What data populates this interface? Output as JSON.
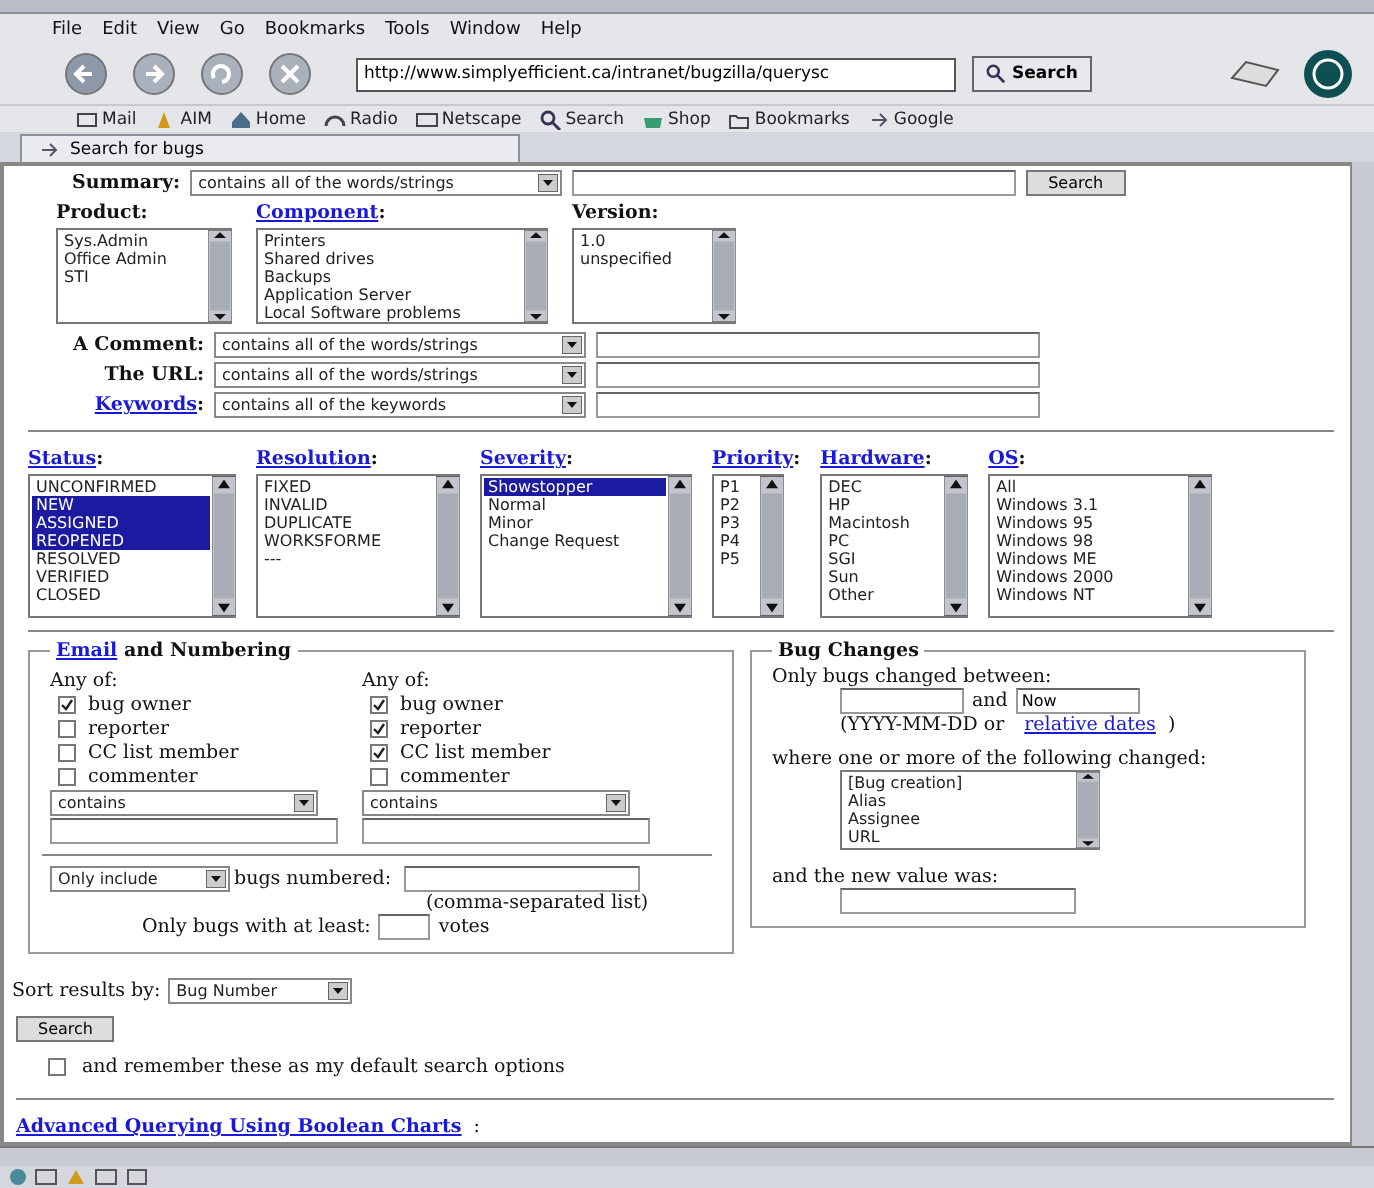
{
  "menu": [
    "File",
    "Edit",
    "View",
    "Go",
    "Bookmarks",
    "Tools",
    "Window",
    "Help"
  ],
  "navigation": {
    "url": "http://www.simplyefficient.ca/intranet/bugzilla/querysc",
    "search_button": "Search"
  },
  "personal_bar": [
    {
      "kind": "mail",
      "label": "Mail"
    },
    {
      "kind": "aim",
      "label": "AIM"
    },
    {
      "kind": "home",
      "label": "Home"
    },
    {
      "kind": "radio",
      "label": "Radio"
    },
    {
      "kind": "netscape",
      "label": "Netscape"
    },
    {
      "kind": "search",
      "label": "Search"
    },
    {
      "kind": "shop",
      "label": "Shop"
    },
    {
      "kind": "folder",
      "label": "Bookmarks"
    },
    {
      "kind": "link",
      "label": "Google"
    }
  ],
  "tab": {
    "label": "Search for bugs",
    "selected": true
  },
  "summary": {
    "label": "Summary:",
    "operator": "contains all of the words/strings",
    "button": "Search"
  },
  "pickers": [
    {
      "label": "Product",
      "link": false,
      "colon": ":",
      "options": [
        {
          "text": "Sys.Admin",
          "selected": false
        },
        {
          "text": "Office Admin",
          "selected": false
        },
        {
          "text": "STI",
          "selected": false
        }
      ]
    },
    {
      "label": "Component",
      "link": true,
      "colon": ":",
      "options": [
        {
          "text": "Printers",
          "selected": false
        },
        {
          "text": "Shared drives",
          "selected": false
        },
        {
          "text": "Backups",
          "selected": false
        },
        {
          "text": "Application Server",
          "selected": false
        },
        {
          "text": "Local Software problems",
          "selected": false
        }
      ]
    },
    {
      "label": "Version",
      "link": false,
      "colon": ":",
      "options": [
        {
          "text": "1.0",
          "selected": false
        },
        {
          "text": "unspecified",
          "selected": false
        }
      ]
    }
  ],
  "text_rows": [
    {
      "label": "A Comment",
      "link": false,
      "colon": ":",
      "operator": "contains all of the words/strings"
    },
    {
      "label": "The URL",
      "link": false,
      "colon": ":",
      "operator": "contains all of the words/strings"
    },
    {
      "label": "Keywords",
      "link": true,
      "colon": ":",
      "operator": "contains all of the keywords"
    }
  ],
  "filters": [
    {
      "label": "Status",
      "colon": ":",
      "options": [
        {
          "text": "UNCONFIRMED",
          "selected": false
        },
        {
          "text": "NEW",
          "selected": true
        },
        {
          "text": "ASSIGNED",
          "selected": true
        },
        {
          "text": "REOPENED",
          "selected": true
        },
        {
          "text": "RESOLVED",
          "selected": false
        },
        {
          "text": "VERIFIED",
          "selected": false
        },
        {
          "text": "CLOSED",
          "selected": false
        }
      ]
    },
    {
      "label": "Resolution",
      "colon": ":",
      "options": [
        {
          "text": "FIXED",
          "selected": false
        },
        {
          "text": "INVALID",
          "selected": false
        },
        {
          "text": "DUPLICATE",
          "selected": false
        },
        {
          "text": "WORKSFORME",
          "selected": false
        },
        {
          "text": "---",
          "selected": false
        }
      ]
    },
    {
      "label": "Severity",
      "colon": ":",
      "options": [
        {
          "text": "Showstopper",
          "selected": true
        },
        {
          "text": "Normal",
          "selected": false
        },
        {
          "text": "Minor",
          "selected": false
        },
        {
          "text": "Change Request",
          "selected": false
        }
      ]
    },
    {
      "label": "Priority",
      "colon": ":",
      "options": [
        {
          "text": "P1",
          "selected": false
        },
        {
          "text": "P2",
          "selected": false
        },
        {
          "text": "P3",
          "selected": false
        },
        {
          "text": "P4",
          "selected": false
        },
        {
          "text": "P5",
          "selected": false
        }
      ]
    },
    {
      "label": "Hardware",
      "colon": ":",
      "options": [
        {
          "text": "DEC",
          "selected": false
        },
        {
          "text": "HP",
          "selected": false
        },
        {
          "text": "Macintosh",
          "selected": false
        },
        {
          "text": "PC",
          "selected": false
        },
        {
          "text": "SGI",
          "selected": false
        },
        {
          "text": "Sun",
          "selected": false
        },
        {
          "text": "Other",
          "selected": false
        }
      ]
    },
    {
      "label": "OS",
      "colon": ":",
      "options": [
        {
          "text": "All",
          "selected": false
        },
        {
          "text": "Windows 3.1",
          "selected": false
        },
        {
          "text": "Windows 95",
          "selected": false
        },
        {
          "text": "Windows 98",
          "selected": false
        },
        {
          "text": "Windows ME",
          "selected": false
        },
        {
          "text": "Windows 2000",
          "selected": false
        },
        {
          "text": "Windows NT",
          "selected": false
        }
      ]
    }
  ],
  "email": {
    "legend_link": "Email",
    "legend_rest": "and Numbering",
    "columns": [
      {
        "heading": "Any of:",
        "checks": [
          {
            "label": "bug owner",
            "checked": true
          },
          {
            "label": "reporter",
            "checked": false
          },
          {
            "label": "CC list member",
            "checked": false
          },
          {
            "label": "commenter",
            "checked": false
          }
        ],
        "operator": "contains"
      },
      {
        "heading": "Any of:",
        "checks": [
          {
            "label": "bug owner",
            "checked": true
          },
          {
            "label": "reporter",
            "checked": true
          },
          {
            "label": "CC list member",
            "checked": true
          },
          {
            "label": "commenter",
            "checked": false
          }
        ],
        "operator": "contains"
      }
    ],
    "include": "Only include",
    "numbered": "bugs numbered:",
    "hint": "(comma-separated list)",
    "votes_label": "Only bugs with at least:",
    "votes_unit": "votes"
  },
  "bug_changes": {
    "legend": "Bug Changes",
    "between": "Only bugs changed between:",
    "and": "and",
    "to_value": "Now",
    "format_pre": "(YYYY-MM-DD or",
    "format_link": "relative dates",
    "format_post": ")",
    "where": "where one or more of the following changed:",
    "fields": [
      {
        "text": "[Bug creation]",
        "selected": false
      },
      {
        "text": "Alias",
        "selected": false
      },
      {
        "text": "Assignee",
        "selected": false
      },
      {
        "text": "URL",
        "selected": false
      }
    ],
    "new_value": "and the new value was:"
  },
  "sort": {
    "label": "Sort results by:",
    "value": "Bug Number"
  },
  "search_button": "Search",
  "remember": {
    "label": "and remember these as my default search options",
    "checked": false
  },
  "advanced": {
    "link": "Advanced Querying Using Boolean Charts",
    "suffix": ":"
  }
}
